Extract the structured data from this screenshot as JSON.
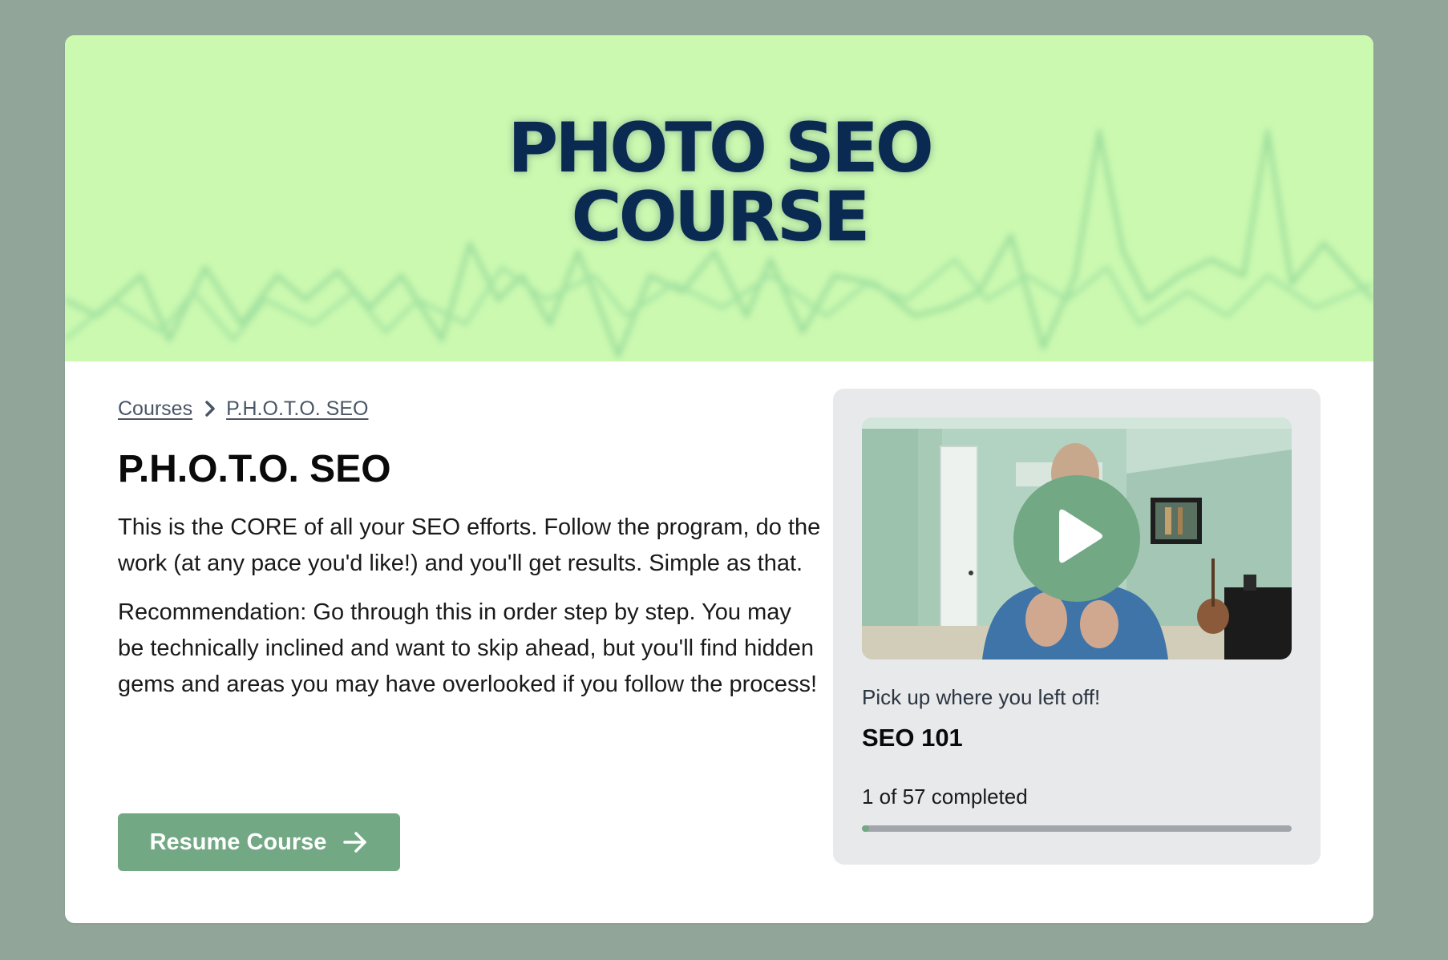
{
  "banner": {
    "title_line1": "PHOTO SEO",
    "title_line2": "COURSE",
    "bg_color": "#cbf9b0",
    "title_color": "#0b2a52"
  },
  "breadcrumb": {
    "items": [
      {
        "label": "Courses"
      },
      {
        "label": "P.H.O.T.O. SEO"
      }
    ],
    "separator_icon": "chevron-right-icon"
  },
  "course": {
    "title": "P.H.O.T.O. SEO",
    "description_1": "This is the CORE of all your SEO efforts. Follow the program, do the work (at any pace you'd like!) and you'll get results. Simple as that.",
    "description_2": "Recommendation: Go through this in order step by step. You may be technically inclined and want to skip ahead, but you'll find hidden gems and areas you may have overlooked if you follow the process!"
  },
  "resume_button": {
    "label": "Resume Course",
    "icon": "arrow-right-icon",
    "color": "#72a884"
  },
  "side_panel": {
    "video_icon": "play-icon",
    "pickup_text": "Pick up where you left off!",
    "lesson_title": "SEO 101",
    "progress_text": "1 of 57 completed",
    "progress_completed": 1,
    "progress_total": 57,
    "accent_color": "#72a884"
  }
}
